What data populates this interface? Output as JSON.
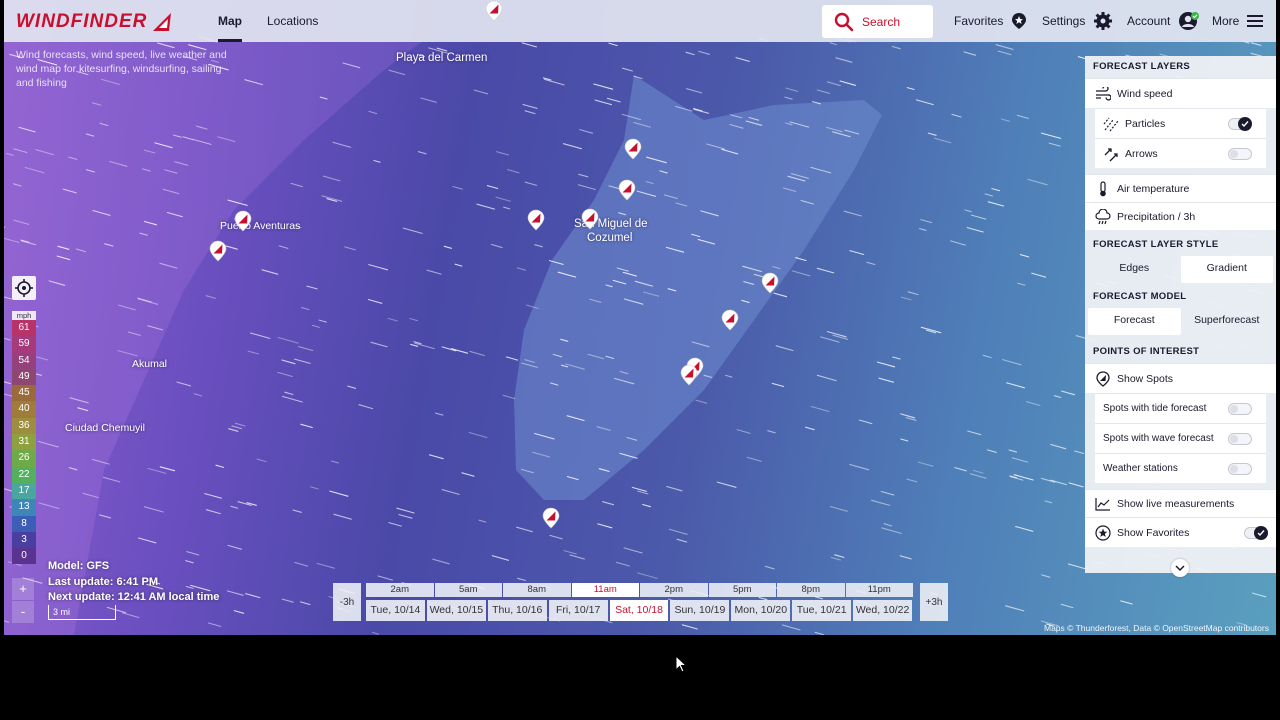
{
  "header": {
    "logo": "WINDFINDER",
    "tabs": [
      {
        "label": "Map",
        "active": true
      },
      {
        "label": "Locations",
        "active": false
      }
    ],
    "search_label": "Search",
    "favorites_label": "Favorites",
    "settings_label": "Settings",
    "account_label": "Account",
    "more_label": "More"
  },
  "tagline": "Wind forecasts, wind speed, live weather and wind map for kitesurfing, windsurfing, sailing and fishing",
  "places": {
    "playa": "Playa del Carmen",
    "puerto": "Puerto Aventuras",
    "cozumel_1": "San Miguel de",
    "cozumel_2": "Cozumel",
    "akumal": "Akumal",
    "chemuyil": "Ciudad Chemuyil"
  },
  "legend": {
    "unit": "mph",
    "values": [
      "61",
      "59",
      "54",
      "49",
      "45",
      "40",
      "36",
      "31",
      "26",
      "22",
      "17",
      "13",
      "8",
      "3",
      "0"
    ],
    "colors": [
      "#b8336a",
      "#a63a7a",
      "#96407e",
      "#8e4770",
      "#9a6a3c",
      "#a07c3a",
      "#9c8e3e",
      "#8ea040",
      "#6eaa48",
      "#52b05e",
      "#4aa7a0",
      "#3f86b8",
      "#3b5eb6",
      "#4a3ea0",
      "#5a3290"
    ]
  },
  "zoom": {
    "plus": "+",
    "minus": "-"
  },
  "model_info": {
    "model": "Model: GFS",
    "last_update": "Last update: 6:41 PM",
    "next_update": "Next update: 12:41 AM local time"
  },
  "scale_label": "3 mi",
  "timeline": {
    "prev": "-3h",
    "next": "+3h",
    "hours": [
      {
        "label": "2am",
        "active": false
      },
      {
        "label": "5am",
        "active": false
      },
      {
        "label": "8am",
        "active": false
      },
      {
        "label": "11am",
        "active": true
      },
      {
        "label": "2pm",
        "active": false
      },
      {
        "label": "5pm",
        "active": false
      },
      {
        "label": "8pm",
        "active": false
      },
      {
        "label": "11pm",
        "active": false
      }
    ],
    "days": [
      {
        "label": "Tue, 10/14",
        "active": false
      },
      {
        "label": "Wed, 10/15",
        "active": false
      },
      {
        "label": "Thu, 10/16",
        "active": false
      },
      {
        "label": "Fri, 10/17",
        "active": false
      },
      {
        "label": "Sat, 10/18",
        "active": true
      },
      {
        "label": "Sun, 10/19",
        "active": false
      },
      {
        "label": "Mon, 10/20",
        "active": false
      },
      {
        "label": "Tue, 10/21",
        "active": false
      },
      {
        "label": "Wed, 10/22",
        "active": false
      }
    ]
  },
  "attribution": "Maps © Thunderforest, Data © OpenStreetMap contributors",
  "panel": {
    "forecast_layers_title": "FORECAST LAYERS",
    "wind_speed": "Wind speed",
    "particles": "Particles",
    "particles_on": true,
    "arrows": "Arrows",
    "arrows_on": false,
    "air_temperature": "Air temperature",
    "precipitation": "Precipitation / 3h",
    "layer_style_title": "FORECAST LAYER STYLE",
    "style_options": [
      {
        "label": "Edges",
        "selected": false
      },
      {
        "label": "Gradient",
        "selected": true
      }
    ],
    "model_title": "FORECAST MODEL",
    "model_options": [
      {
        "label": "Forecast",
        "selected": true
      },
      {
        "label": "Superforecast",
        "selected": false
      }
    ],
    "poi_title": "POINTS OF INTEREST",
    "show_spots": "Show Spots",
    "tide_spots": "Spots with tide forecast",
    "tide_on": false,
    "wave_spots": "Spots with wave forecast",
    "wave_on": false,
    "weather_stations": "Weather stations",
    "stations_on": false,
    "live_measurements": "Show live measurements",
    "show_favorites": "Show Favorites",
    "favorites_on": true
  },
  "colors": {
    "brand": "#c8102e",
    "dark": "#1a1a2e"
  }
}
